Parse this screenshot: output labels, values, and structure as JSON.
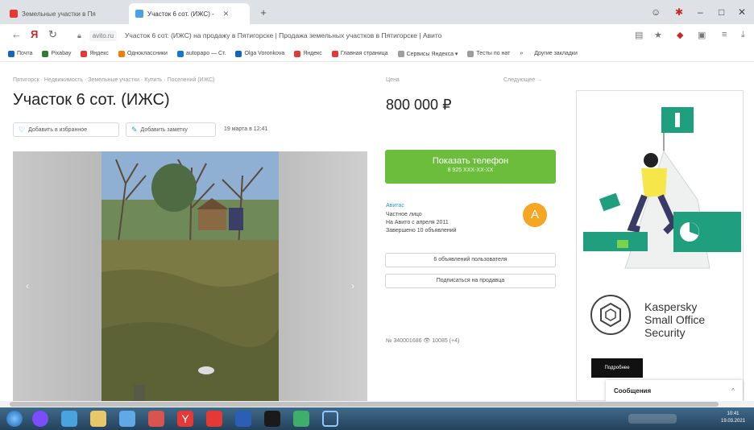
{
  "browser": {
    "tabs": [
      {
        "label": "Земельные участки в Пя",
        "active": false,
        "favicon_color": "#e53935"
      },
      {
        "label": "Участок 6 сот. (ИЖС) - ",
        "active": true,
        "favicon_color": "#4aa3df"
      }
    ],
    "new_tab_label": "+",
    "window_controls": {
      "minimize": "–",
      "maximize": "□",
      "close": "✕"
    },
    "address": {
      "domain": "avito.ru",
      "page_title": "Участок 6 сот. (ИЖС) на продажу в Пятигорске | Продажа земельных участков в Пятигорске | Авито"
    },
    "bookmarks": [
      {
        "label": "Почта",
        "color": "#1565c0"
      },
      {
        "label": "Pixabay",
        "color": "#2e7d32"
      },
      {
        "label": "Яндекс",
        "color": "#e53935"
      },
      {
        "label": "Одноклассники",
        "color": "#f57c00"
      },
      {
        "label": "autopapo — Ст.",
        "color": "#1976d2"
      },
      {
        "label": "Olga Voronkova",
        "color": "#1565c0"
      },
      {
        "label": "Яндекс",
        "color": "#e53935"
      },
      {
        "label": "Главная страница",
        "color": "#e53935"
      },
      {
        "label": "Сервисы Яндекса ▾",
        "color": "#9e9e9e"
      },
      {
        "label": "Тесты по нат",
        "color": "#9e9e9e"
      }
    ],
    "bookmarks_more": "»",
    "other_bookmarks": "Другие закладки"
  },
  "listing": {
    "breadcrumbs": "Пятигорск · Недвижимость · Земельные участки · Купить · Поселений (ИЖС)",
    "title": "Участок 6 сот. (ИЖС)",
    "add_favorite": "Добавить в избранное",
    "add_note": "Добавить заметку",
    "date": "19 марта в 12:41",
    "price_label": "Цена",
    "next_label": "Следующее →",
    "price": "800 000 ₽",
    "phone_button": "Показать телефон",
    "phone_masked": "8 925 XXX-XX-XX",
    "seller": {
      "name": "Авитас",
      "type": "Частное лицо",
      "since": "На Авито с апреля 2011",
      "completed": "Завершено 10 объявлений",
      "avatar_letter": "А"
    },
    "seller_listings_button": "6 объявлений пользователя",
    "subscribe_button": "Подписаться на продавца",
    "meta": "№ 340001686  👁 10085 (+4)"
  },
  "ad": {
    "brand_lines": [
      "Kaspersky",
      "Small Office",
      "Security"
    ],
    "button_label": "Подробнее"
  },
  "chat": {
    "label": "Сообщения",
    "toggle": "^"
  },
  "taskbar": {
    "time": "10:41",
    "date": "19.03.2021"
  }
}
